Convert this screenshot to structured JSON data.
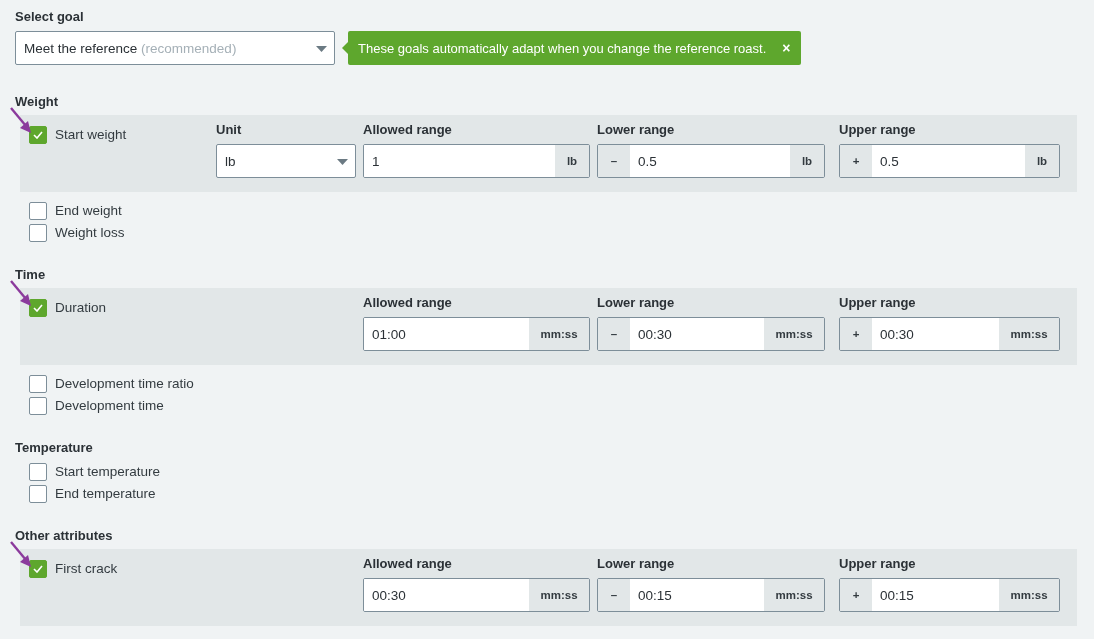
{
  "goal": {
    "label": "Select goal",
    "value": "Meet the reference",
    "hint": "(recommended)",
    "toast": {
      "text": "These goals automatically adapt when you change the reference roast.",
      "close": "×"
    }
  },
  "sections": [
    {
      "title": "Weight",
      "items": [
        {
          "label": "Start weight",
          "checked": true,
          "annotated": true,
          "fields": [
            {
              "kind": "select",
              "label": "Unit",
              "value": "lb"
            },
            {
              "kind": "range",
              "label": "Allowed range",
              "value": "1",
              "suffix": "lb"
            },
            {
              "kind": "range",
              "label": "Lower range",
              "prefix": "–",
              "value": "0.5",
              "suffix": "lb"
            },
            {
              "kind": "range",
              "label": "Upper range",
              "prefix": "+",
              "value": "0.5",
              "suffix": "lb"
            }
          ]
        },
        {
          "label": "End weight",
          "checked": false,
          "annotated": false
        },
        {
          "label": "Weight loss",
          "checked": false,
          "annotated": false
        }
      ]
    },
    {
      "title": "Time",
      "items": [
        {
          "label": "Duration",
          "checked": true,
          "annotated": true,
          "fields": [
            {
              "kind": "range",
              "label": "Allowed range",
              "value": "01:00",
              "suffix": "mm:ss"
            },
            {
              "kind": "range",
              "label": "Lower range",
              "prefix": "–",
              "value": "00:30",
              "suffix": "mm:ss"
            },
            {
              "kind": "range",
              "label": "Upper range",
              "prefix": "+",
              "value": "00:30",
              "suffix": "mm:ss"
            }
          ]
        },
        {
          "label": "Development time ratio",
          "checked": false,
          "annotated": false
        },
        {
          "label": "Development time",
          "checked": false,
          "annotated": false
        }
      ]
    },
    {
      "title": "Temperature",
      "items": [
        {
          "label": "Start temperature",
          "checked": false,
          "annotated": false
        },
        {
          "label": "End temperature",
          "checked": false,
          "annotated": false
        }
      ]
    },
    {
      "title": "Other attributes",
      "items": [
        {
          "label": "First crack",
          "checked": true,
          "annotated": true,
          "fields": [
            {
              "kind": "range",
              "label": "Allowed range",
              "value": "00:30",
              "suffix": "mm:ss"
            },
            {
              "kind": "range",
              "label": "Lower range",
              "prefix": "–",
              "value": "00:15",
              "suffix": "mm:ss"
            },
            {
              "kind": "range",
              "label": "Upper range",
              "prefix": "+",
              "value": "00:15",
              "suffix": "mm:ss"
            }
          ]
        }
      ]
    }
  ]
}
